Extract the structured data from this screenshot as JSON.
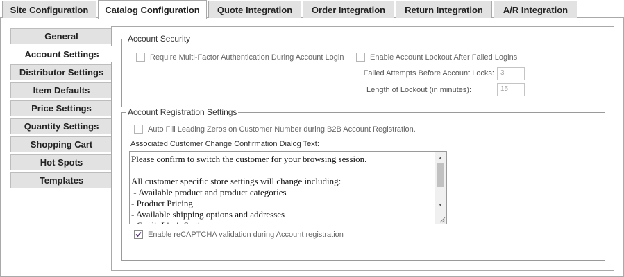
{
  "tabs": [
    {
      "label": "Site Configuration",
      "active": false
    },
    {
      "label": "Catalog Configuration",
      "active": true
    },
    {
      "label": "Quote Integration",
      "active": false
    },
    {
      "label": "Order Integration",
      "active": false
    },
    {
      "label": "Return Integration",
      "active": false
    },
    {
      "label": "A/R Integration",
      "active": false
    }
  ],
  "sidebar": {
    "items": [
      {
        "label": "General",
        "active": false
      },
      {
        "label": "Account Settings",
        "active": true
      },
      {
        "label": "Distributor Settings",
        "active": false
      },
      {
        "label": "Item Defaults",
        "active": false
      },
      {
        "label": "Price Settings",
        "active": false
      },
      {
        "label": "Quantity Settings",
        "active": false
      },
      {
        "label": "Shopping Cart",
        "active": false
      },
      {
        "label": "Hot Spots",
        "active": false
      },
      {
        "label": "Templates",
        "active": false
      }
    ]
  },
  "account_security": {
    "legend": "Account Security",
    "mfa": {
      "label": "Require Multi-Factor Authentication During Account Login",
      "checked": false
    },
    "lockout": {
      "label": "Enable Account Lockout After Failed Logins",
      "checked": false
    },
    "failed_attempts": {
      "label": "Failed Attempts Before Account Locks:",
      "value": "3"
    },
    "lockout_length": {
      "label": "Length of Lockout (in minutes):",
      "value": "15"
    }
  },
  "account_registration": {
    "legend": "Account Registration Settings",
    "auto_fill": {
      "label": "Auto Fill Leading Zeros on Customer Number during B2B Account Registration.",
      "checked": false
    },
    "dialog_label": "Associated Customer Change Confirmation Dialog Text:",
    "dialog_text": "Please confirm to switch the customer for your browsing session.\n\nAll customer specific store settings will change including:\n - Available product and product categories\n- Product Pricing\n- Available shipping options and addresses\n- Credit Limit Settings",
    "recaptcha": {
      "label": "Enable reCAPTCHA validation during Account registration",
      "checked": true
    }
  }
}
